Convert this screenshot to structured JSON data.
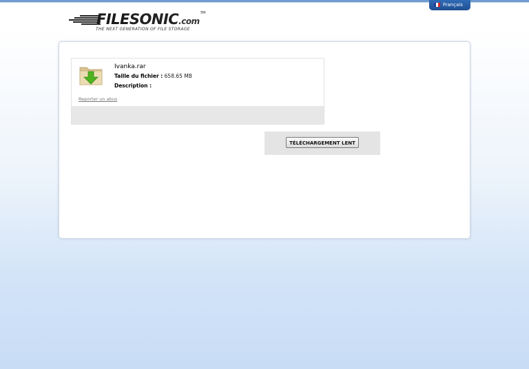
{
  "header": {
    "language": "Français",
    "logo": {
      "file": "FILE",
      "sonic": "SONIC",
      "com": ".com",
      "tm": "TM",
      "tagline": "THE NEXT GENERATION OF FILE STORAGE"
    }
  },
  "file": {
    "name": "Ivanka.rar",
    "size_label": "Taille du fichier :",
    "size_value": "658.65 MB",
    "description_label": "Description :",
    "report_link": "Reporter un abus"
  },
  "download": {
    "slow_button": "TÉLÉCHARGEMENT LENT"
  },
  "colors": {
    "accent_blue": "#2f6bb5",
    "arrow_green": "#4fb321",
    "folder_tan": "#e6d3a6"
  }
}
